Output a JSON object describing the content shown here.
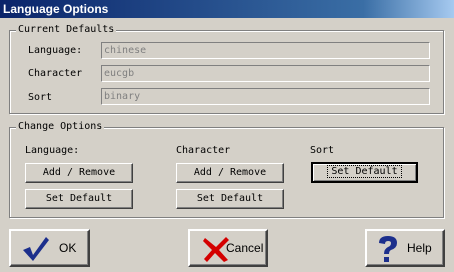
{
  "window": {
    "title": "Language Options"
  },
  "current_defaults": {
    "title": "Current Defaults",
    "language_label": "Language:",
    "language_value": "chinese",
    "character_label": "Character",
    "character_value": "eucgb",
    "sort_label": "Sort",
    "sort_value": "binary"
  },
  "change_options": {
    "title": "Change Options",
    "language_label": "Language:",
    "character_label": "Character",
    "sort_label": "Sort",
    "language_add_remove": "Add / Remove",
    "language_set_default": "Set Default",
    "character_add_remove": "Add / Remove",
    "character_set_default": "Set Default",
    "sort_set_default": "Set Default"
  },
  "buttons": {
    "ok": "OK",
    "cancel": "Cancel",
    "help": "Help"
  },
  "icons": {
    "ok": "checkmark-icon",
    "cancel": "x-icon",
    "help": "question-mark-icon"
  },
  "colors": {
    "titlebar": "#0a246a",
    "face": "#d4d0c8",
    "ok_check": "#1c2f8c",
    "cancel_x": "#d40000",
    "help_q": "#1c2f8c"
  }
}
